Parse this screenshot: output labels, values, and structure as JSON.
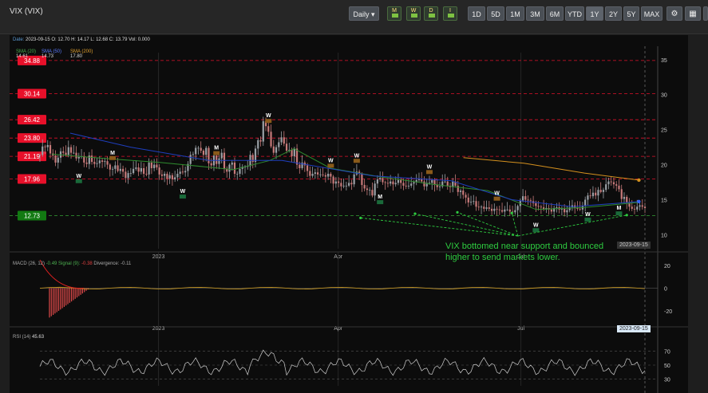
{
  "header": {
    "symbol": "VIX (VIX)",
    "interval_label": "Daily ▾",
    "ranges": [
      "1D",
      "5D",
      "1M",
      "3M",
      "6M",
      "YTD",
      "1Y",
      "2Y",
      "5Y",
      "MAX"
    ],
    "active_range": "1Y",
    "type_icons": [
      "M",
      "W",
      "D",
      "I"
    ]
  },
  "info": {
    "date_label": "Date:",
    "date": "2023-09-15",
    "ohlc": "O: 12.70  H: 14.17  L: 12.68  C: 13.79  Vol: 0.000",
    "sma20": "SMA (20)",
    "sma20_val": "14.61",
    "sma50": "SMA (50)",
    "sma50_val": "14.73",
    "sma200": "SMA (200)",
    "sma200_val": "17.80"
  },
  "macd": {
    "label": "MACD (26, 12)",
    "signal": "-0.49",
    "divergence": "-0.11",
    "extra": "-0.38"
  },
  "rsi": {
    "label": "RSI (14)",
    "value": "45.63"
  },
  "annotation": {
    "line1": "VIX bottomed near support and bounced",
    "line2": "higher to send markets lower."
  },
  "last_date": "2023-09-15",
  "colors": {
    "candle_up": "#9aa0a6",
    "candle_down": "#c77a7a",
    "sma20": "#2e8b2e",
    "sma50": "#1f3fbf",
    "sma200": "#d4901e",
    "level_red": "#e0102a",
    "level_green": "#1a8a1a",
    "annotation": "#2ecc40"
  },
  "chart_data": [
    {
      "type": "candlestick",
      "title": "VIX (VIX)",
      "ylim": [
        8,
        36
      ],
      "y_ticks": [
        10,
        15,
        20,
        25,
        30,
        35
      ],
      "x_ticks": [
        "2023",
        "Apr",
        "Jul"
      ],
      "levels_red": [
        34.88,
        30.14,
        26.42,
        23.8,
        21.19,
        17.96
      ],
      "levels_green": [
        12.73
      ],
      "close_series": [
        21.4,
        22.6,
        22.5,
        22.8,
        21.6,
        21.3,
        20.3,
        21.0,
        21.9,
        21.7,
        21.4,
        22.5,
        21.7,
        21.7,
        20.9,
        21.1,
        21.2,
        20.3,
        20.1,
        21.3,
        20.4,
        20.1,
        20.2,
        20.6,
        20.4,
        20.5,
        20.0,
        19.3,
        19.4,
        19.9,
        19.1,
        19.4,
        19.0,
        18.1,
        18.8,
        18.8,
        19.4,
        19.6,
        19.0,
        19.5,
        18.7,
        18.6,
        20.3,
        19.5,
        20.0,
        19.6,
        18.6,
        18.4,
        18.7,
        18.0,
        18.5,
        17.9,
        18.2,
        18.7,
        19.0,
        18.9,
        19.1,
        20.1,
        21.4,
        21.5,
        22.4,
        22.4,
        22.0,
        21.4,
        22.4,
        20.2,
        19.9,
        21.3,
        20.1,
        20.9,
        21.7,
        19.4,
        19.0,
        20.0,
        20.3,
        18.7,
        18.7,
        19.4,
        19.7,
        19.7,
        19.8,
        21.4,
        20.4,
        22.3,
        23.5,
        23.3,
        26.2,
        25.5,
        24.7,
        22.6,
        21.7,
        22.5,
        23.2,
        23.9,
        23.0,
        22.0,
        22.1,
        21.2,
        22.3,
        20.0,
        19.5,
        20.3,
        19.9,
        19.1,
        18.4,
        18.7,
        18.9,
        18.6,
        18.6,
        18.5,
        18.3,
        18.7,
        18.3,
        17.3,
        17.6,
        17.4,
        16.9,
        17.0,
        17.0,
        17.4,
        17.2,
        18.6,
        19.0,
        18.7,
        17.1,
        16.6,
        16.4,
        16.4,
        15.6,
        17.3,
        17.9,
        18.1,
        17.5,
        17.4,
        17.3,
        17.6,
        17.2,
        17.4,
        17.8,
        17.4,
        17.0,
        16.9,
        17.0,
        17.3,
        17.5,
        17.8,
        17.9,
        17.6,
        16.9,
        17.4,
        17.4,
        17.8,
        17.1,
        16.8,
        16.9,
        17.6,
        17.6,
        17.0,
        16.8,
        17.6,
        17.0,
        16.1,
        16.3,
        15.7,
        15.3,
        14.6,
        14.7,
        14.8,
        14.0,
        13.9,
        14.0,
        13.7,
        13.9,
        13.7,
        13.4,
        13.7,
        13.6,
        13.5,
        13.3,
        13.6,
        13.6,
        13.3,
        13.2,
        13.5,
        14.1,
        14.9,
        15.5,
        15.0,
        14.9,
        14.8,
        14.5,
        14.1,
        14.0,
        13.9,
        13.6,
        13.8,
        13.6,
        13.3,
        13.8,
        13.9,
        13.6,
        13.7,
        13.2,
        13.5,
        13.9,
        14.2,
        13.8,
        13.7,
        13.6,
        14.1,
        15.0,
        15.6,
        15.5,
        16.0,
        15.6,
        16.4,
        16.1,
        16.4,
        17.2,
        17.6,
        17.5,
        17.2,
        17.0,
        16.5,
        15.1,
        15.4,
        14.6,
        14.0,
        13.7,
        13.6,
        14.0,
        14.2,
        14.0,
        13.8
      ],
      "sma20": [
        {
          "x": 0.02,
          "y": 21.5
        },
        {
          "x": 0.12,
          "y": 20.8
        },
        {
          "x": 0.2,
          "y": 20.3
        },
        {
          "x": 0.32,
          "y": 19.3
        },
        {
          "x": 0.38,
          "y": 20.6
        },
        {
          "x": 0.42,
          "y": 22.3
        },
        {
          "x": 0.48,
          "y": 19.5
        },
        {
          "x": 0.56,
          "y": 18.3
        },
        {
          "x": 0.65,
          "y": 17.2
        },
        {
          "x": 0.74,
          "y": 16.3
        },
        {
          "x": 0.82,
          "y": 13.6
        },
        {
          "x": 0.9,
          "y": 13.9
        },
        {
          "x": 0.99,
          "y": 14.61
        }
      ],
      "sma50": [
        {
          "x": 0.05,
          "y": 24.5
        },
        {
          "x": 0.15,
          "y": 22.5
        },
        {
          "x": 0.28,
          "y": 20.6
        },
        {
          "x": 0.4,
          "y": 20.6
        },
        {
          "x": 0.55,
          "y": 18.4
        },
        {
          "x": 0.68,
          "y": 17.7
        },
        {
          "x": 0.78,
          "y": 15.0
        },
        {
          "x": 0.88,
          "y": 14.0
        },
        {
          "x": 0.99,
          "y": 14.73
        }
      ],
      "sma200": [
        {
          "x": 0.7,
          "y": 21.0
        },
        {
          "x": 0.8,
          "y": 20.2
        },
        {
          "x": 0.9,
          "y": 18.8
        },
        {
          "x": 0.99,
          "y": 17.8
        }
      ],
      "signals": [
        {
          "i": 15,
          "t": "W"
        },
        {
          "i": 28,
          "t": "M"
        },
        {
          "i": 55,
          "t": "W"
        },
        {
          "i": 68,
          "t": "M"
        },
        {
          "i": 88,
          "t": "W"
        },
        {
          "i": 112,
          "t": "W"
        },
        {
          "i": 122,
          "t": "W"
        },
        {
          "i": 131,
          "t": "M"
        },
        {
          "i": 150,
          "t": "W"
        },
        {
          "i": 176,
          "t": "W"
        },
        {
          "i": 191,
          "t": "W"
        },
        {
          "i": 211,
          "t": "W"
        },
        {
          "i": 223,
          "t": "M"
        }
      ]
    },
    {
      "type": "histogram",
      "title": "MACD (26, 12)",
      "ylim": [
        -30,
        25
      ],
      "y_ticks": [
        -20,
        0,
        20
      ]
    },
    {
      "type": "line",
      "title": "RSI (14)",
      "ylim": [
        20,
        80
      ],
      "y_ticks": [
        30,
        50,
        70
      ]
    }
  ]
}
